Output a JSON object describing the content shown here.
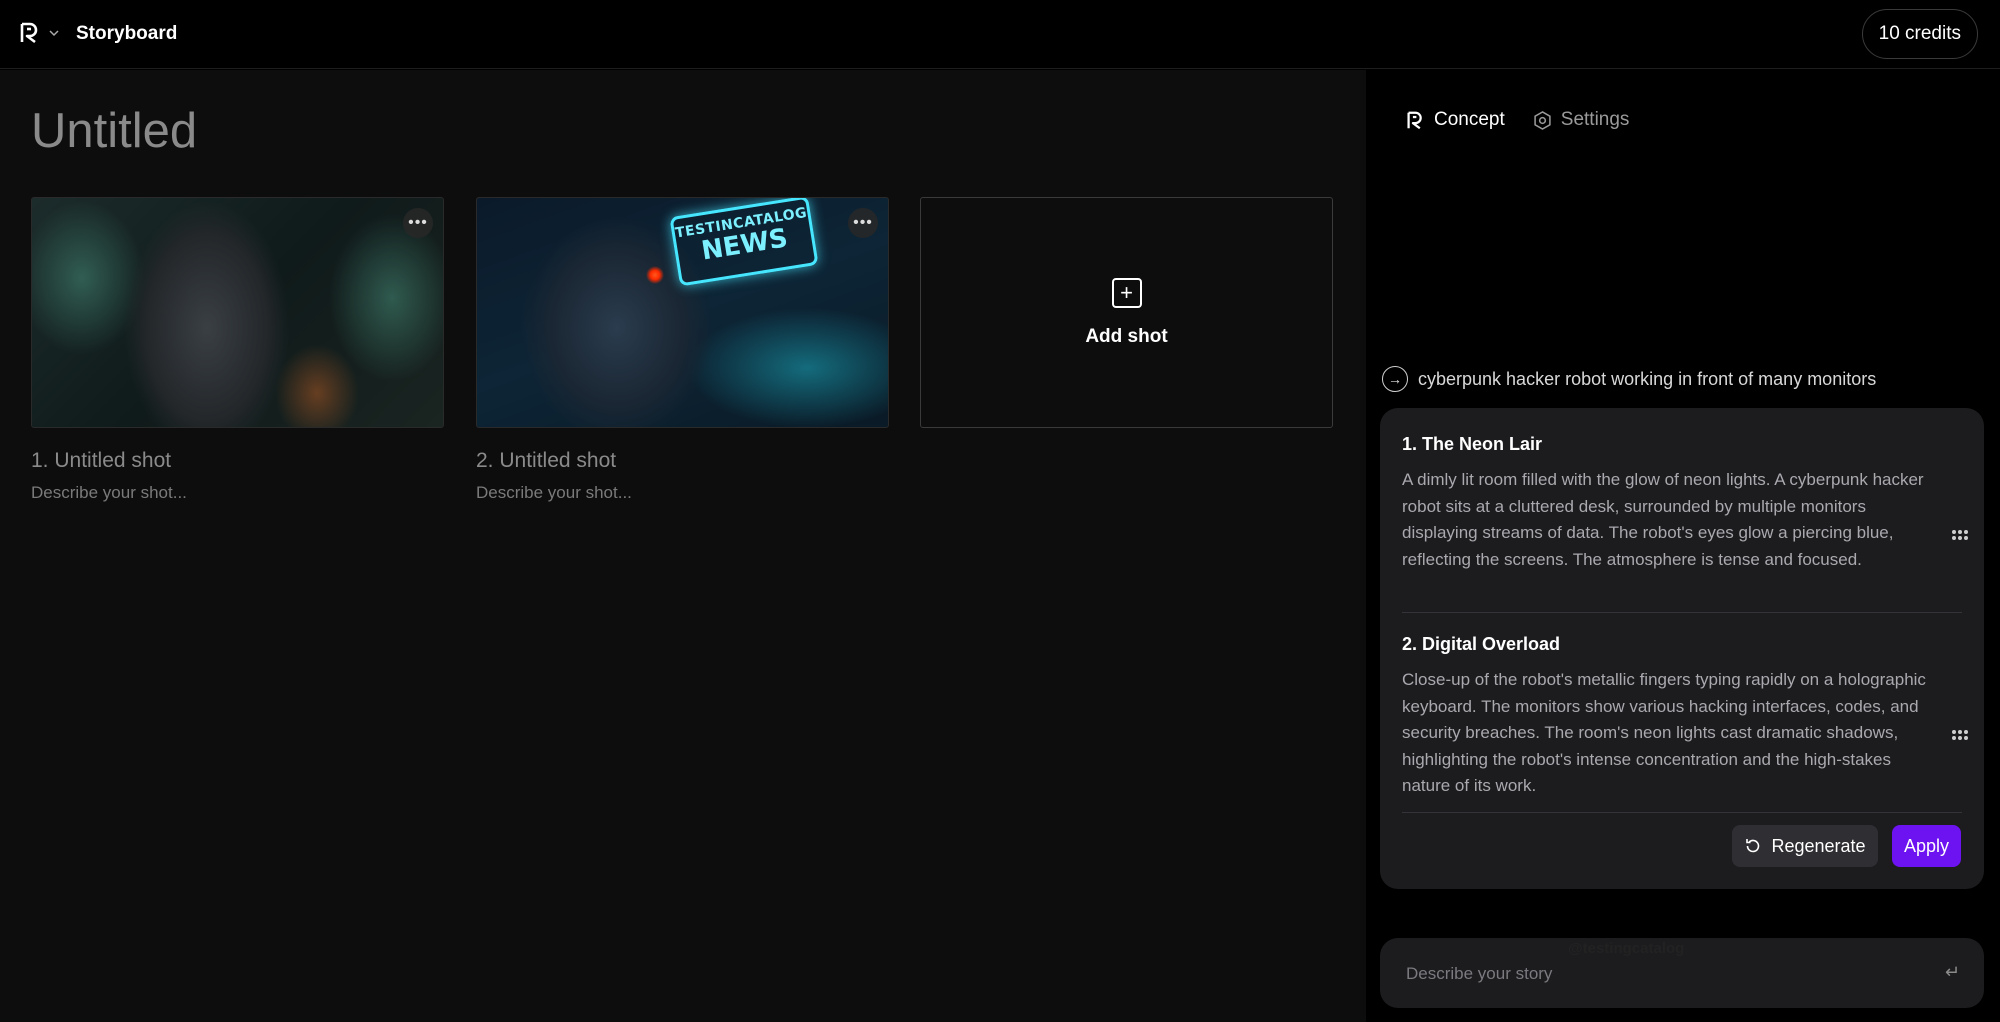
{
  "header": {
    "app_title": "Storyboard",
    "credits": "10 credits"
  },
  "main": {
    "title": "Untitled",
    "shots": [
      {
        "title": "1. Untitled shot",
        "description": "Describe your shot...",
        "more": "•••"
      },
      {
        "title": "2. Untitled shot",
        "description": "Describe your shot...",
        "more": "•••"
      }
    ],
    "shot2_sign": {
      "line1": "TESTINCATALOG",
      "line2": "NEWS"
    },
    "add_shot_label": "Add shot"
  },
  "panel": {
    "tabs": [
      {
        "label": "Concept",
        "icon": "logo-icon",
        "active": true
      },
      {
        "label": "Settings",
        "icon": "gear-icon",
        "active": false
      }
    ],
    "prompt": "cyberpunk hacker robot working in front of many monitors",
    "scenes": [
      {
        "title": "1. The Neon Lair",
        "body": "A dimly lit room filled with the glow of neon lights. A cyberpunk hacker robot sits at a cluttered desk, surrounded by multiple monitors displaying streams of data. The robot's eyes glow a piercing blue, reflecting the screens. The atmosphere is tense and focused."
      },
      {
        "title": "2. Digital Overload",
        "body": "Close-up of the robot's metallic fingers typing rapidly on a holographic keyboard. The monitors show various hacking interfaces, codes, and security breaches. The room's neon lights cast dramatic shadows, highlighting the robot's intense concentration and the high-stakes nature of its work."
      }
    ],
    "regenerate_label": "Regenerate",
    "apply_label": "Apply",
    "watermark": "@testingcatalog",
    "story_input": {
      "value": "",
      "placeholder": "Describe your story"
    }
  },
  "colors": {
    "accent": "#6d12f0",
    "background": "#000000",
    "canvas": "#0d0d0d",
    "card": "#1c1c1f"
  }
}
